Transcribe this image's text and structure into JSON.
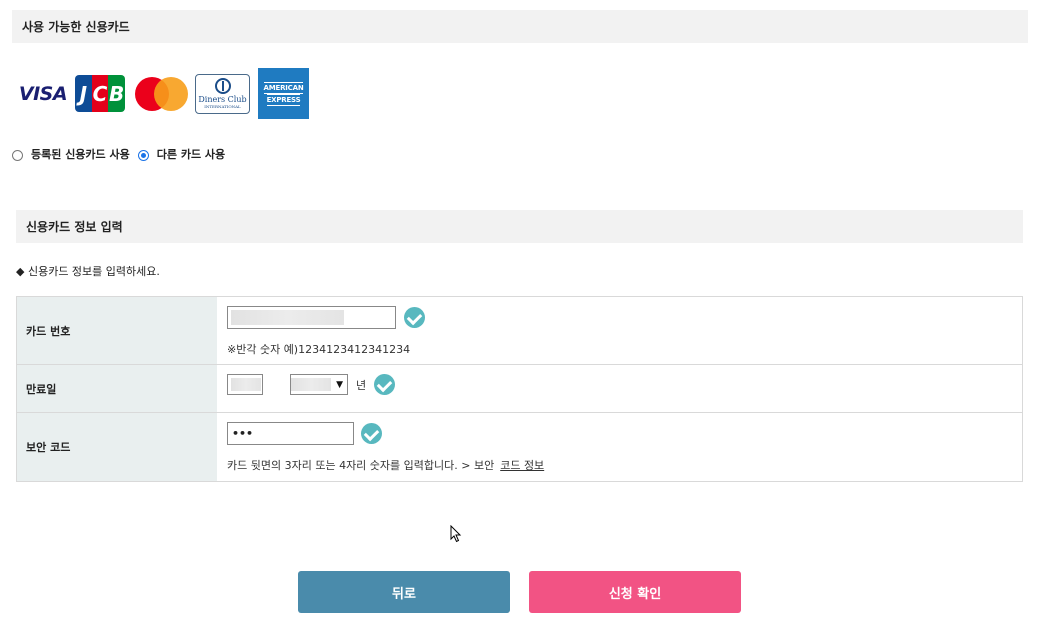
{
  "sections": {
    "available_cards_title": "사용 가능한 신용카드",
    "card_info_title": "신용카드 정보 입력"
  },
  "logos": {
    "visa": "VISA",
    "jcb": [
      "J",
      "C",
      "B"
    ],
    "diners_line1": "Diners Club",
    "diners_line2": "INTERNATIONAL",
    "amex_line1": "AMERICAN",
    "amex_line2": "EXPRESS"
  },
  "payment_choice": {
    "options": [
      {
        "label": "등록된 신용카드 사용",
        "checked": false
      },
      {
        "label": "다른 카드 사용",
        "checked": true
      }
    ]
  },
  "instruction": "◆ 신용카드 정보를 입력하세요.",
  "form": {
    "card_number": {
      "label": "카드 번호",
      "hint": "※반각 숫자 예)1234123412341234"
    },
    "expiry": {
      "label": "만료일",
      "year_suffix": "년"
    },
    "security_code": {
      "label": "보안 코드",
      "value": "•••",
      "hint": "카드 뒷면의 3자리 또는 4자리 숫자를 입력합니다. > 보안",
      "hint_link": "코드 정보"
    }
  },
  "buttons": {
    "back": "뒤로",
    "confirm": "신청 확인"
  },
  "colors": {
    "back_button": "#4a8bab",
    "confirm_button": "#f25384",
    "check_icon": "#58b8bf",
    "label_bg": "#e9efef"
  }
}
